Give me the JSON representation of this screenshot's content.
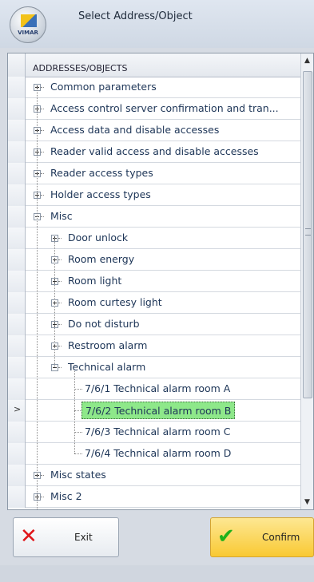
{
  "window": {
    "title": "Select Address/Object",
    "logo_text": "VIMAR"
  },
  "table": {
    "column_header": "ADDRESSES/OBJECTS",
    "selected_row_indicator": ">",
    "rows": [
      {
        "label": "Common parameters",
        "level": 0,
        "expander": "plus"
      },
      {
        "label": "Access control server confirmation and tran...",
        "level": 0,
        "expander": "plus"
      },
      {
        "label": "Access data and disable accesses",
        "level": 0,
        "expander": "plus"
      },
      {
        "label": "Reader valid access and disable accesses",
        "level": 0,
        "expander": "plus"
      },
      {
        "label": "Reader access types",
        "level": 0,
        "expander": "plus"
      },
      {
        "label": "Holder access types",
        "level": 0,
        "expander": "plus"
      },
      {
        "label": "Misc",
        "level": 0,
        "expander": "minus"
      },
      {
        "label": "Door unlock",
        "level": 1,
        "expander": "plus"
      },
      {
        "label": "Room energy",
        "level": 1,
        "expander": "plus"
      },
      {
        "label": "Room light",
        "level": 1,
        "expander": "plus"
      },
      {
        "label": "Room curtesy light",
        "level": 1,
        "expander": "plus"
      },
      {
        "label": "Do not disturb",
        "level": 1,
        "expander": "plus"
      },
      {
        "label": "Restroom alarm",
        "level": 1,
        "expander": "plus"
      },
      {
        "label": "Technical alarm",
        "level": 1,
        "expander": "minus"
      },
      {
        "label": "7/6/1 Technical alarm room A",
        "level": 2,
        "expander": "none"
      },
      {
        "label": "7/6/2 Technical alarm room B",
        "level": 2,
        "expander": "none",
        "selected": true
      },
      {
        "label": "7/6/3 Technical alarm room C",
        "level": 2,
        "expander": "none"
      },
      {
        "label": "7/6/4 Technical alarm room D",
        "level": 2,
        "expander": "none"
      },
      {
        "label": "Misc states",
        "level": 0,
        "expander": "plus"
      },
      {
        "label": "Misc 2",
        "level": 0,
        "expander": "plus"
      }
    ]
  },
  "buttons": {
    "exit_label": "Exit",
    "exit_icon": "x-icon",
    "confirm_label": "Confirm",
    "confirm_icon": "checkmark-icon"
  },
  "colors": {
    "selection": "#8ee88a",
    "exit_icon": "#e0161a",
    "confirm_icon": "#1fb21a",
    "confirm_button": "#f9c933"
  }
}
